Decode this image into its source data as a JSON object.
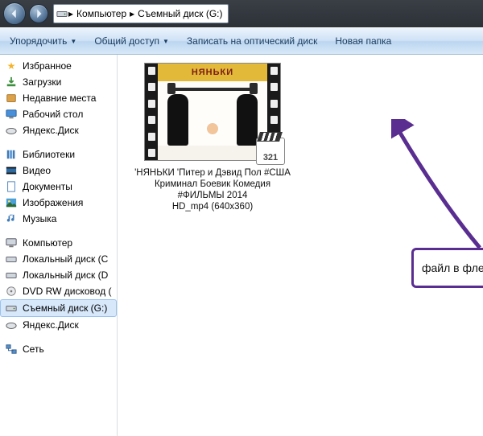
{
  "breadcrumb": {
    "root": "Компьютер",
    "current": "Съемный диск (G:)"
  },
  "toolbar": {
    "organize": "Упорядочить",
    "share": "Общий доступ",
    "burn": "Записать на оптический диск",
    "newfolder": "Новая папка"
  },
  "nav": {
    "favorites": {
      "header": "Избранное",
      "downloads": "Загрузки",
      "recent": "Недавние места",
      "desktop": "Рабочий стол",
      "yandex": "Яндекс.Диск"
    },
    "libraries": {
      "header": "Библиотеки",
      "video": "Видео",
      "documents": "Документы",
      "pictures": "Изображения",
      "music": "Музыка"
    },
    "computer": {
      "header": "Компьютер",
      "c": "Локальный диск (С",
      "d": "Локальный диск (D",
      "dvd": "DVD RW дисковод (",
      "g": "Съемный диск (G:)",
      "yd": "Яндекс.Диск"
    },
    "network": {
      "header": "Сеть"
    }
  },
  "file": {
    "poster_title": "НЯНЬКИ",
    "player_badge": "321",
    "caption_l1": "'НЯНЬКИ 'Питер и Дэвид Пол #США",
    "caption_l2": "Криминал Боевик Комедия #ФИЛЬМЫ 2014",
    "caption_l3": "HD_mp4 (640x360)"
  },
  "annotation": {
    "text": "файл в флешке",
    "color": "#5a2e91"
  }
}
